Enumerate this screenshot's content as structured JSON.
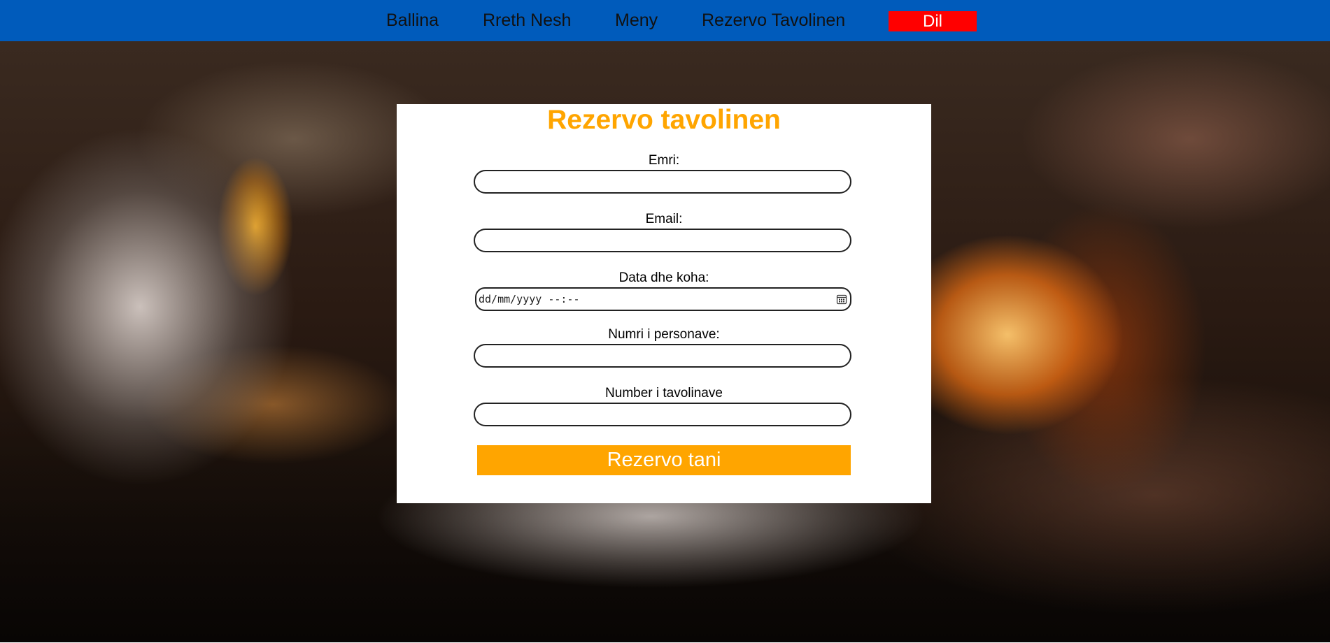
{
  "nav": {
    "links": [
      "Ballina",
      "Rreth Nesh",
      "Meny",
      "Rezervo Tavolinen"
    ],
    "language_label": "Dil"
  },
  "form": {
    "title": "Rezervo tavolinen",
    "fields": [
      {
        "label": "Emri:",
        "value": ""
      },
      {
        "label": "Email:",
        "value": ""
      },
      {
        "label": "Data dhe koha:",
        "placeholder": "dd/mm/yyyy --:--"
      },
      {
        "label": "Numri i personave:",
        "value": ""
      },
      {
        "label": "Number i tavolinave",
        "value": ""
      }
    ],
    "submit_label": "Rezervo tani"
  },
  "colors": {
    "navbar": "#005bbb",
    "language_button": "#ff0000",
    "accent": "#ffa500",
    "card": "#ffffff"
  },
  "icons": {
    "date_picker": "calendar-icon"
  }
}
